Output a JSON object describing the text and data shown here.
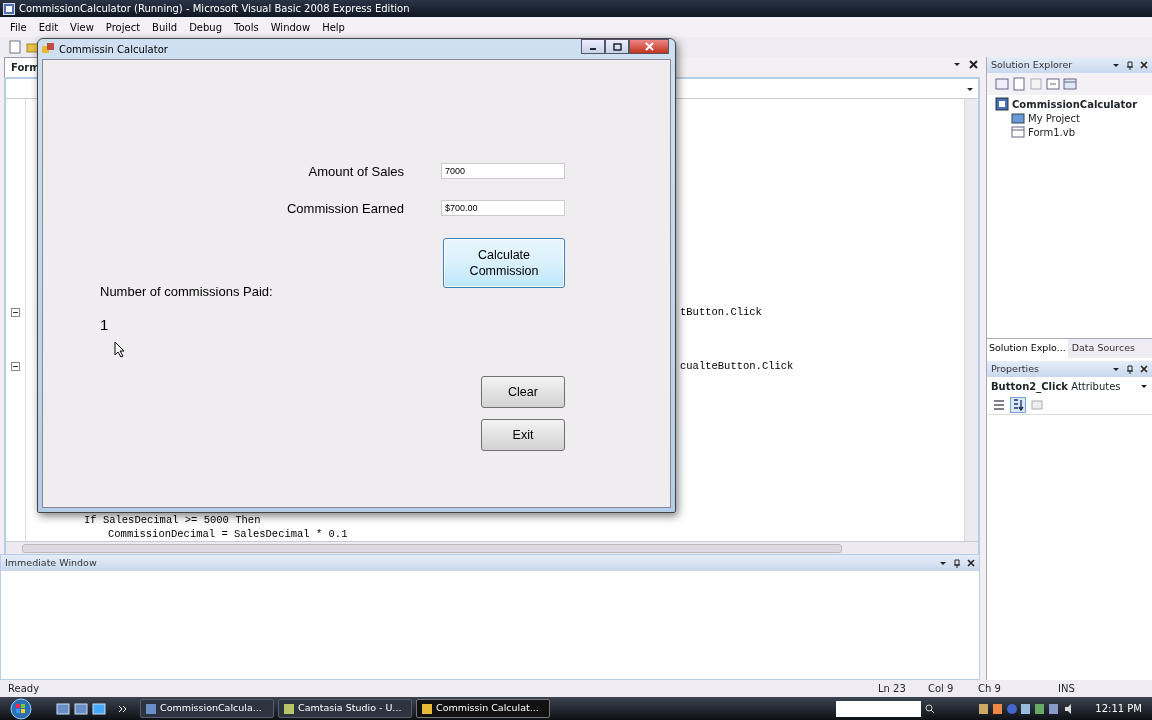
{
  "ide": {
    "title": "CommissionCalculator (Running) - Microsoft Visual Basic 2008 Express Edition",
    "menu": [
      "File",
      "Edit",
      "View",
      "Project",
      "Build",
      "Debug",
      "Tools",
      "Window",
      "Help"
    ],
    "doc_tabs": [
      {
        "label": "Form",
        "selected": true
      }
    ],
    "code_lines": [
      {
        "text": "tButton.Click",
        "kind": "tail"
      },
      {
        "text": "cualteButton.Click",
        "kind": "tail"
      },
      {
        "text": "If SalesDecimal >= 5000 Then",
        "kind": "body"
      },
      {
        "text": "CommissionDecimal = SalesDecimal * 0.1",
        "kind": "body2"
      }
    ],
    "solution_explorer": {
      "title": "Solution Explorer",
      "root": {
        "label": "CommissionCalculator",
        "expanded": true,
        "children": [
          {
            "label": "My Project",
            "kind": "project"
          },
          {
            "label": "Form1.vb",
            "kind": "form"
          }
        ]
      }
    },
    "side_tabs": [
      {
        "label": "Solution Explo...",
        "selected": true
      },
      {
        "label": "Data Sources",
        "selected": false
      }
    ],
    "properties": {
      "title": "Properties",
      "object": "Button2_Click",
      "object_type": "Attributes",
      "sort_alpha": true
    },
    "immediate": {
      "title": "Immediate Window"
    },
    "status_bar": {
      "message": "Ready",
      "line": "Ln 23",
      "col": "Col 9",
      "ch": "Ch 9",
      "mode": "INS"
    }
  },
  "form": {
    "title": "Commissin Calculator",
    "fields": [
      {
        "label": "Amount of Sales",
        "value": "7000"
      },
      {
        "label": "Commission Earned",
        "value": "$700.00"
      }
    ],
    "calculate_button": "Calculate Commission",
    "count_label": "Number of commissions Paid:",
    "count_value": "1",
    "buttons": [
      {
        "label": "Clear"
      },
      {
        "label": "Exit"
      }
    ]
  },
  "taskbar": {
    "items": [
      {
        "label": "CommissionCalcula...",
        "selected": false
      },
      {
        "label": "Camtasia Studio - U...",
        "selected": false
      },
      {
        "label": "Commissin Calculat...",
        "selected": true
      }
    ],
    "clock": "12:11 PM"
  }
}
